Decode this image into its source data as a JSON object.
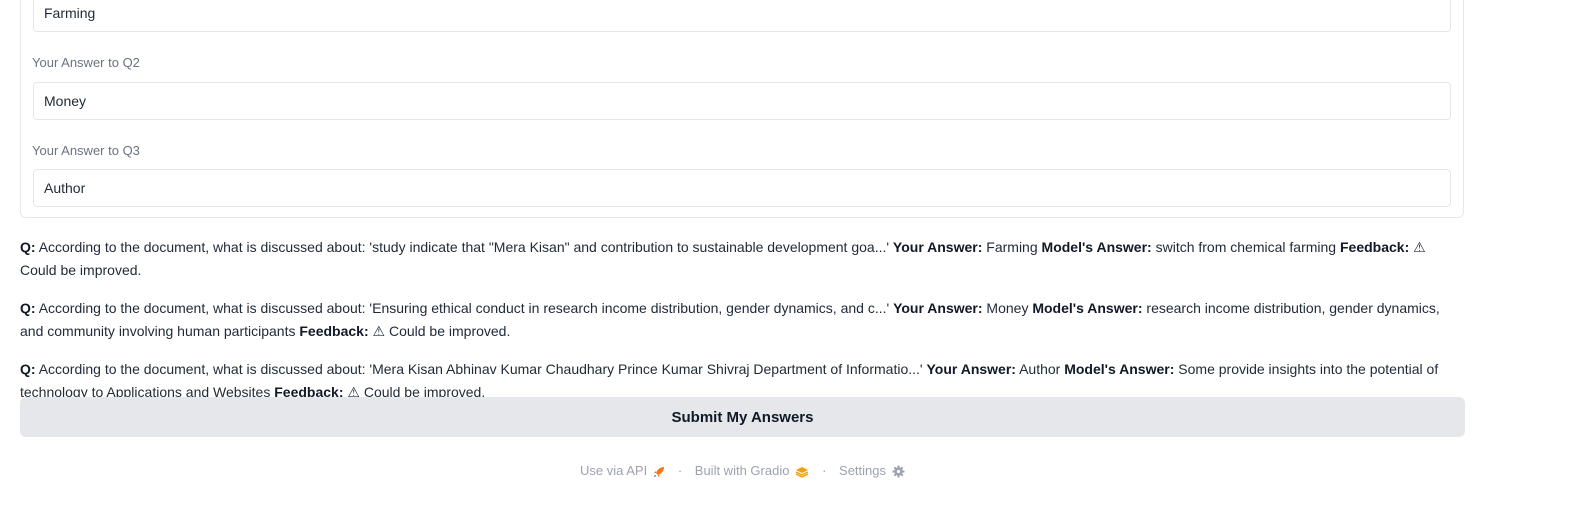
{
  "form": {
    "q1_answer": "Farming",
    "q2_label": "Your Answer to Q2",
    "q2_answer": "Money",
    "q3_label": "Your Answer to Q3",
    "q3_answer": "Author"
  },
  "results": [
    {
      "q_label": "Q:",
      "question": "According to the document, what is discussed about: 'study indicate that \"Mera Kisan\" and contribution to sustainable development goa...'",
      "your_label": "Your Answer:",
      "your_answer": "Farming",
      "model_label": "Model's Answer:",
      "model_answer": "switch from chemical farming",
      "feedback_label": "Feedback:",
      "feedback": "⚠ Could be improved."
    },
    {
      "q_label": "Q:",
      "question": "According to the document, what is discussed about: 'Ensuring ethical conduct in research income distribution, gender dynamics, and c...'",
      "your_label": "Your Answer:",
      "your_answer": "Money",
      "model_label": "Model's Answer:",
      "model_answer": "research income distribution, gender dynamics, and community involving human participants",
      "feedback_label": "Feedback:",
      "feedback": "⚠ Could be improved."
    },
    {
      "q_label": "Q:",
      "question": "According to the document, what is discussed about: 'Mera Kisan Abhinav Kumar Chaudhary Prince Kumar Shivraj Department of Informatio...'",
      "your_label": "Your Answer:",
      "your_answer": "Author",
      "model_label": "Model's Answer:",
      "model_answer": "Some provide insights into the potential of technology to Applications and Websites",
      "feedback_label": "Feedback:",
      "feedback": "⚠ Could be improved."
    }
  ],
  "submit_label": "Submit My Answers",
  "footer": {
    "api_label": "Use via API",
    "gradio_label": "Built with Gradio",
    "settings_label": "Settings",
    "separator": "·",
    "icons": {
      "api": "rocket-icon",
      "gradio": "gradio-logo-icon",
      "settings": "gear-icon"
    },
    "colors": {
      "rocket": "#f97316",
      "gradio": "#f59e0b",
      "settings": "#9ca3af"
    }
  }
}
